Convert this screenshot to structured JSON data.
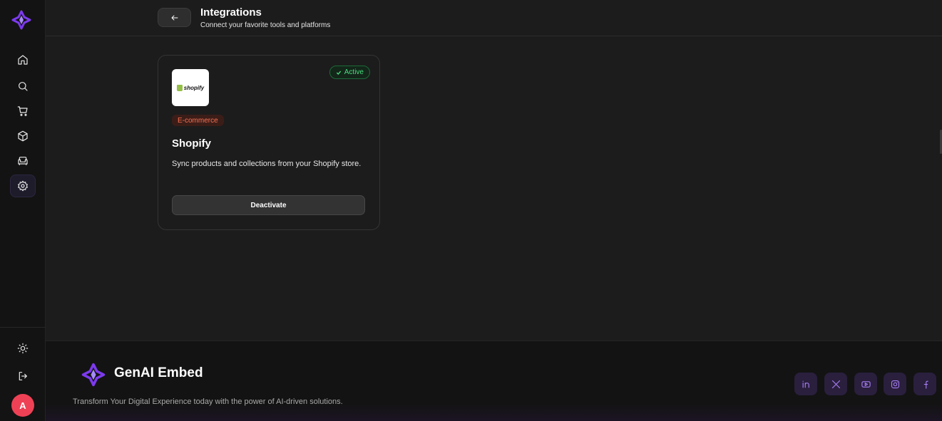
{
  "header": {
    "title": "Integrations",
    "subtitle": "Connect your favorite tools and platforms"
  },
  "sidebar": {
    "items": [
      {
        "name": "home-icon"
      },
      {
        "name": "search-icon"
      },
      {
        "name": "cart-icon"
      },
      {
        "name": "box-icon"
      },
      {
        "name": "sofa-icon"
      },
      {
        "name": "settings-icon",
        "active": true
      }
    ],
    "bottom": [
      {
        "name": "sun-icon"
      },
      {
        "name": "logout-icon"
      }
    ],
    "avatar_initial": "A"
  },
  "integration": {
    "logo_text": "shopify",
    "status": "Active",
    "category": "E-commerce",
    "name": "Shopify",
    "description": "Sync products and collections from your Shopify store.",
    "action_label": "Deactivate"
  },
  "footer": {
    "brand": "GenAI Embed",
    "tagline": "Transform Your Digital Experience today with the power of AI-driven solutions.",
    "socials": [
      "linkedin-icon",
      "x-icon",
      "youtube-icon",
      "instagram-icon",
      "facebook-icon"
    ]
  },
  "colors": {
    "accent": "#8b5cf6",
    "status_active": "#4ade80",
    "category": "#f87150",
    "avatar": "#ef4155"
  }
}
